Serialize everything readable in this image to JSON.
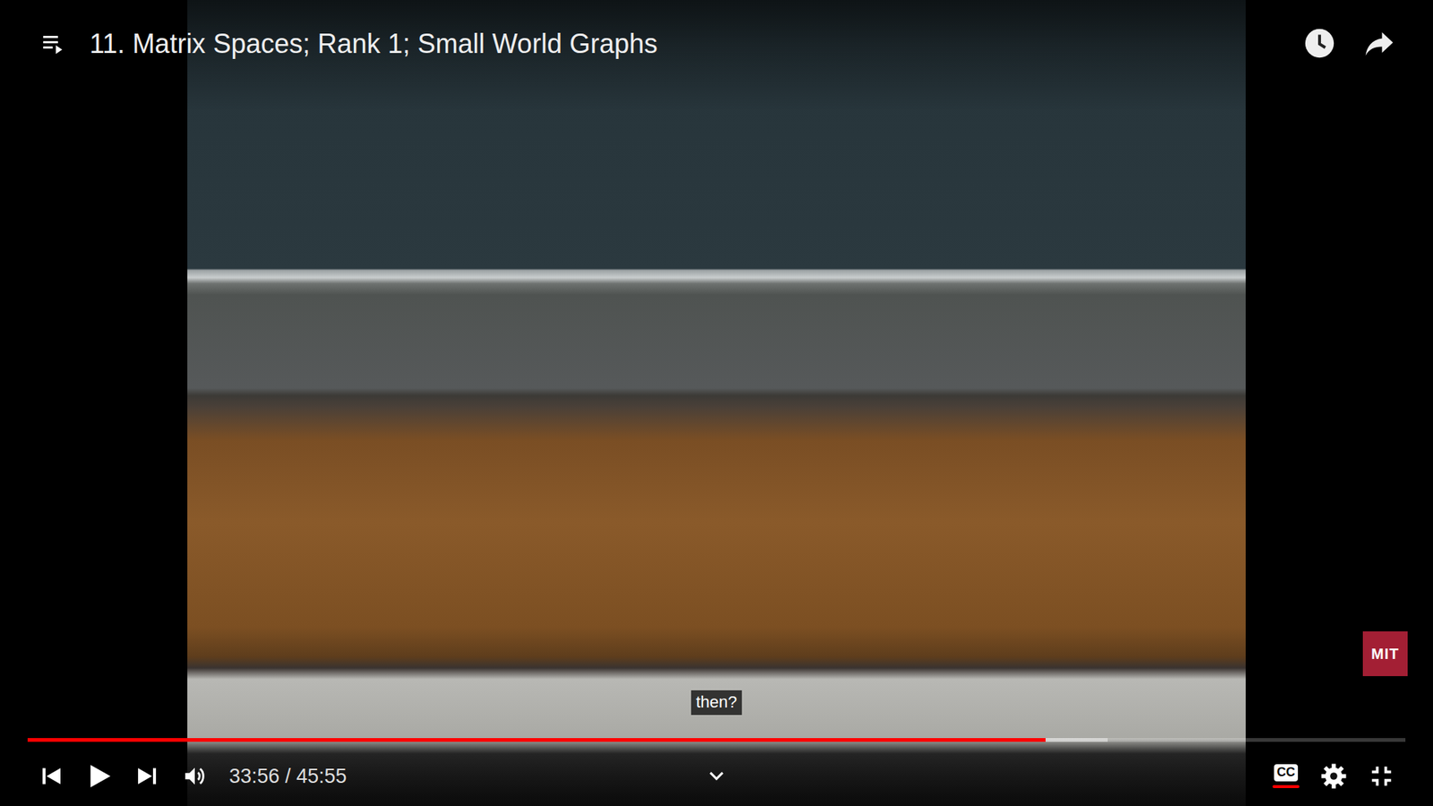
{
  "player": {
    "title": "11. Matrix Spaces; Rank 1; Small World Graphs",
    "caption": "then?",
    "logo": "MIT",
    "time": "33:56 / 45:55",
    "cc_label": "CC",
    "captions_on": true,
    "playing": false,
    "progress": {
      "level": 0.739,
      "buffered": 0.784
    }
  }
}
